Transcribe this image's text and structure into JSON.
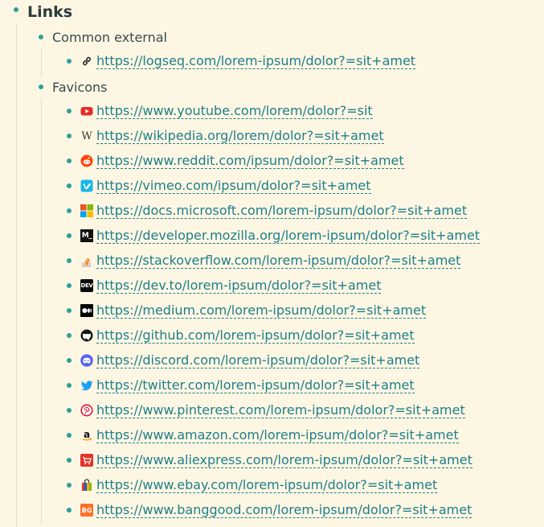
{
  "block": {
    "title": "Links",
    "groups": [
      {
        "label": "Common external",
        "links": [
          {
            "icon": "chain-link-icon",
            "url": "https://logseq.com/lorem-ipsum/dolor?=sit+amet"
          }
        ]
      },
      {
        "label": "Favicons",
        "links": [
          {
            "icon": "youtube-icon",
            "url": "https://www.youtube.com/lorem/dolor?=sit"
          },
          {
            "icon": "wikipedia-icon",
            "url": "https://wikipedia.org/lorem/dolor?=sit+amet"
          },
          {
            "icon": "reddit-icon",
            "url": "https://www.reddit.com/ipsum/dolor?=sit+amet"
          },
          {
            "icon": "vimeo-icon",
            "url": "https://vimeo.com/ipsum/dolor?=sit+amet"
          },
          {
            "icon": "microsoft-icon",
            "url": "https://docs.microsoft.com/lorem-ipsum/dolor?=sit+amet"
          },
          {
            "icon": "mdn-icon",
            "url": "https://developer.mozilla.org/lorem-ipsum/dolor?=sit+amet"
          },
          {
            "icon": "stackoverflow-icon",
            "url": "https://stackoverflow.com/lorem-ipsum/dolor?=sit+amet"
          },
          {
            "icon": "devto-icon",
            "url": "https://dev.to/lorem-ipsum/dolor?=sit+amet"
          },
          {
            "icon": "medium-icon",
            "url": "https://medium.com/lorem-ipsum/dolor?=sit+amet"
          },
          {
            "icon": "github-icon",
            "url": "https://github.com/lorem-ipsum/dolor?=sit+amet"
          },
          {
            "icon": "discord-icon",
            "url": "https://discord.com/lorem-ipsum/dolor?=sit+amet"
          },
          {
            "icon": "twitter-icon",
            "url": "https://twitter.com/lorem-ipsum/dolor?=sit+amet"
          },
          {
            "icon": "pinterest-icon",
            "url": "https://www.pinterest.com/lorem-ipsum/dolor?=sit+amet"
          },
          {
            "icon": "amazon-icon",
            "url": "https://www.amazon.com/lorem-ipsum/dolor?=sit+amet"
          },
          {
            "icon": "aliexpress-icon",
            "url": "https://www.aliexpress.com/lorem-ipsum/dolor?=sit+amet"
          },
          {
            "icon": "ebay-icon",
            "url": "https://www.ebay.com/lorem-ipsum/dolor?=sit+amet"
          },
          {
            "icon": "banggood-icon",
            "url": "https://www.banggood.com/lorem-ipsum/dolor?=sit+amet"
          }
        ]
      }
    ],
    "icon_glyphs": {
      "wikipedia": "W",
      "mdn": "M_",
      "devto": "DEV",
      "banggood": "BG"
    }
  },
  "colors": {
    "background": "#fdf6e3",
    "bullet": "#2aa198",
    "link": "#1e7f8a",
    "guide_line": "#e5dcc3"
  }
}
